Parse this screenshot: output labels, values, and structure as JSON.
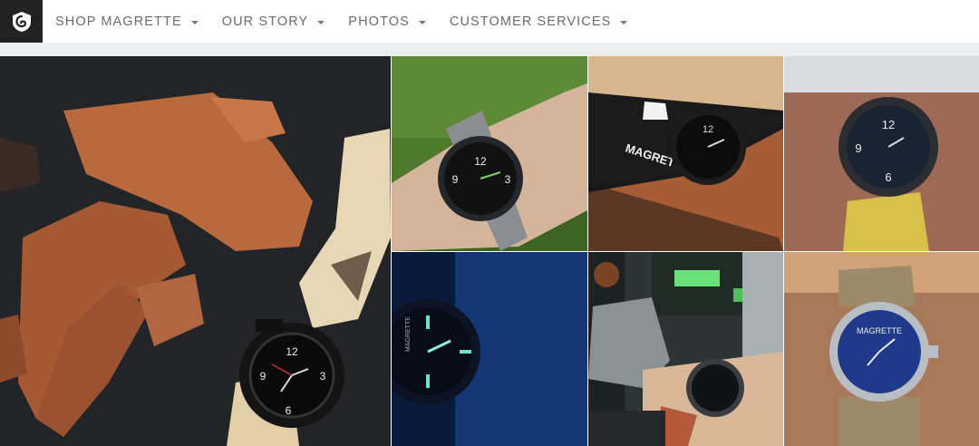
{
  "nav": {
    "items": [
      {
        "label": "SHOP MAGRETTE",
        "id": "shop"
      },
      {
        "label": "OUR STORY",
        "id": "story"
      },
      {
        "label": "PHOTOS",
        "id": "photos"
      },
      {
        "label": "CUSTOMER SERVICES",
        "id": "services"
      }
    ]
  },
  "brand": {
    "accent": "#222222",
    "nav_text_color": "#6b6b6b",
    "subbar_color": "#eceeef"
  },
  "gallery": {
    "watch_dial_text": "MAGRETTE",
    "card_text": "MAGRETTE",
    "dial_numerals": [
      "12",
      "6",
      "9",
      "3"
    ]
  }
}
